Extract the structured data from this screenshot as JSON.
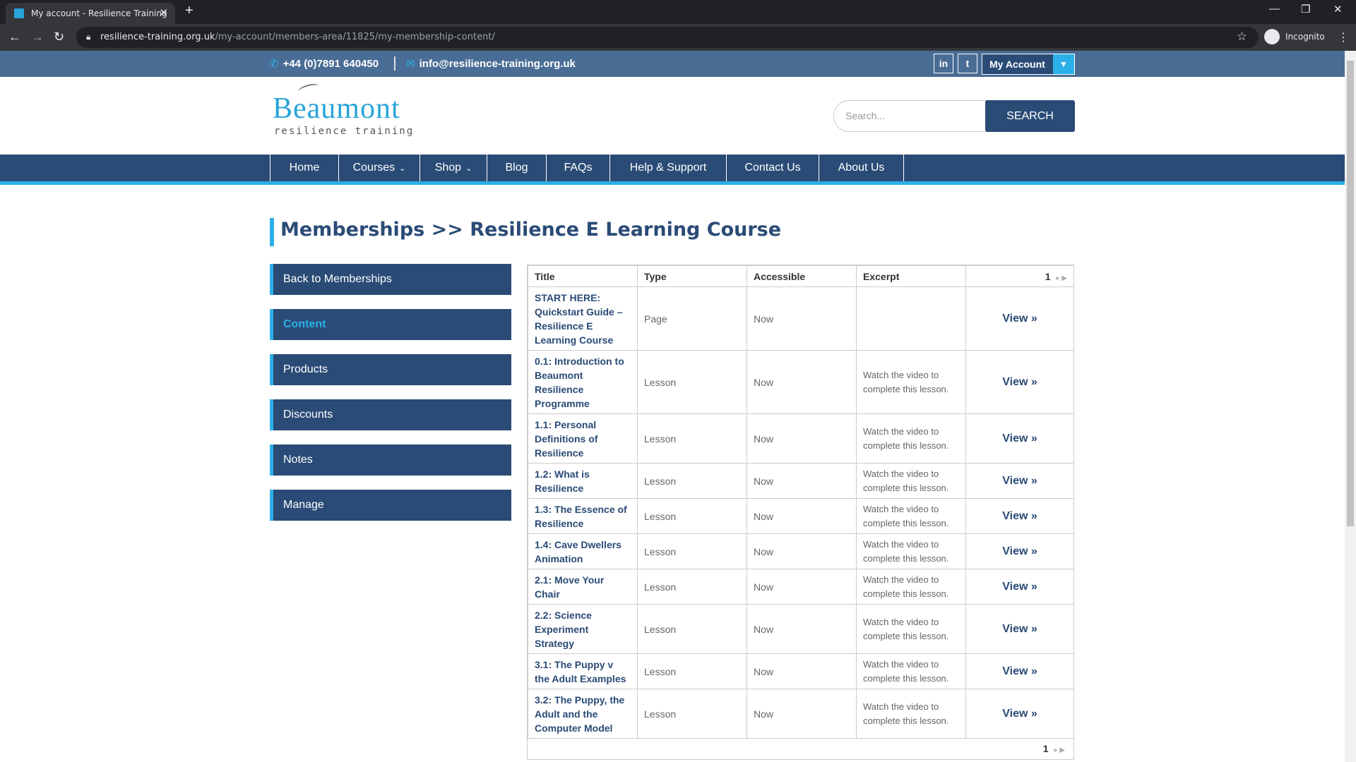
{
  "browser": {
    "tab_title": "My account - Resilience Training",
    "url_host": "resilience-training.org.uk",
    "url_path": "/my-account/members-area/11825/my-membership-content/",
    "profile_label": "Incognito"
  },
  "topbar": {
    "phone": "+44 (0)7891 640450",
    "email": "info@resilience-training.org.uk",
    "linkedin": "in",
    "twitter": "t",
    "my_account": "My Account"
  },
  "header": {
    "logo_name": "Beaumont",
    "logo_sub": "resilience training",
    "search_placeholder": "Search...",
    "search_button": "SEARCH"
  },
  "nav": [
    {
      "label": "Home"
    },
    {
      "label": "Courses"
    },
    {
      "label": "Shop"
    },
    {
      "label": "Blog"
    },
    {
      "label": "FAQs"
    },
    {
      "label": "Help & Support"
    },
    {
      "label": "Contact Us"
    },
    {
      "label": "About Us"
    }
  ],
  "page_title": "Memberships >> Resilience E Learning Course",
  "sidebar": [
    {
      "label": "Back to Memberships"
    },
    {
      "label": "Content"
    },
    {
      "label": "Products"
    },
    {
      "label": "Discounts"
    },
    {
      "label": "Notes"
    },
    {
      "label": "Manage"
    }
  ],
  "table": {
    "headers": {
      "title": "Title",
      "type": "Type",
      "accessible": "Accessible",
      "excerpt": "Excerpt"
    },
    "page": "1",
    "view_label": "View »",
    "rows": [
      {
        "title": "START HERE: Quickstart Guide – Resilience E Learning Course",
        "type": "Page",
        "accessible": "Now",
        "excerpt": ""
      },
      {
        "title": "0.1: Introduction to Beaumont Resilience Programme",
        "type": "Lesson",
        "accessible": "Now",
        "excerpt": "Watch the video to complete this lesson."
      },
      {
        "title": "1.1: Personal Definitions of Resilience",
        "type": "Lesson",
        "accessible": "Now",
        "excerpt": "Watch the video to complete this lesson."
      },
      {
        "title": "1.2: What is Resilience",
        "type": "Lesson",
        "accessible": "Now",
        "excerpt": "Watch the video to complete this lesson."
      },
      {
        "title": "1.3: The Essence of Resilience",
        "type": "Lesson",
        "accessible": "Now",
        "excerpt": "Watch the video to complete this lesson."
      },
      {
        "title": "1.4: Cave Dwellers Animation",
        "type": "Lesson",
        "accessible": "Now",
        "excerpt": "Watch the video to complete this lesson."
      },
      {
        "title": "2.1: Move Your Chair",
        "type": "Lesson",
        "accessible": "Now",
        "excerpt": "Watch the video to complete this lesson."
      },
      {
        "title": "2.2: Science Experiment Strategy",
        "type": "Lesson",
        "accessible": "Now",
        "excerpt": "Watch the video to complete this lesson."
      },
      {
        "title": "3.1: The Puppy v the Adult Examples",
        "type": "Lesson",
        "accessible": "Now",
        "excerpt": "Watch the video to complete this lesson."
      },
      {
        "title": "3.2: The Puppy, the Adult and the Computer Model",
        "type": "Lesson",
        "accessible": "Now",
        "excerpt": "Watch the video to complete this lesson."
      }
    ]
  }
}
